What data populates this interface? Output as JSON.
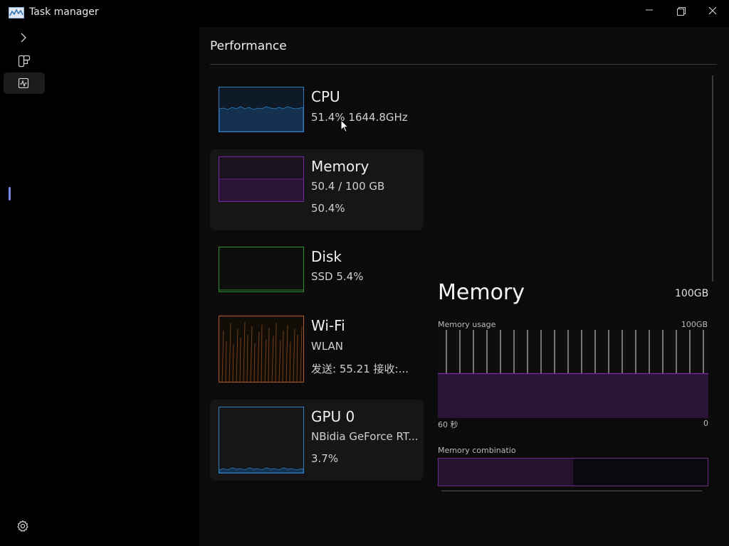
{
  "app": {
    "title": "Task manager",
    "icon": "task-manager-icon"
  },
  "window_controls": {
    "minimize": "minimize-icon",
    "restore": "restore-icon",
    "close": "close-icon"
  },
  "sidebar": {
    "items": [
      {
        "icon": "chevron-right-icon"
      },
      {
        "icon": "processes-icon"
      },
      {
        "icon": "performance-icon",
        "selected": true
      }
    ],
    "settings_icon": "gear-icon"
  },
  "page": {
    "header": "Performance"
  },
  "colors": {
    "cpu": "#2f7fc2",
    "memory": "#7a26a8",
    "disk": "#2e8f2e",
    "wifi": "#b35d22",
    "gpu": "#2f7fc2",
    "indicator": "#7b85e8"
  },
  "devices": [
    {
      "id": "cpu",
      "title": "CPU",
      "line1": "51.4% 1644.8GHz",
      "line2": ""
    },
    {
      "id": "memory",
      "title": "Memory",
      "line1": "50.4 / 100 GB",
      "line2": "50.4%"
    },
    {
      "id": "disk",
      "title": "Disk",
      "line1": "SSD 5.4%",
      "line2": ""
    },
    {
      "id": "wifi",
      "title": "Wi-Fi",
      "line1": "WLAN",
      "line2": "发送: 55.21 接收:..."
    },
    {
      "id": "gpu",
      "title": "GPU 0",
      "line1": "NBidia GeForce RT...",
      "line2": "3.7%"
    }
  ],
  "detail": {
    "title": "Memory",
    "total": "100GB",
    "usage_label": "Memory usage",
    "usage_max": "100GB",
    "axis_left": "60 秒",
    "axis_right": "0",
    "usage_percent": 50.4,
    "combination_label": "Memory combinatio",
    "combination_fill": 0.5
  }
}
